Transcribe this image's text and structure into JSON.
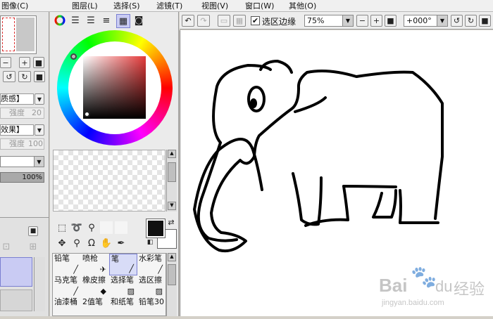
{
  "menu": [
    "图像(C)",
    "图层(L)",
    "选择(S)",
    "滤镜(T)",
    "视图(V)",
    "窗口(W)",
    "其他(O)"
  ],
  "left_panel": {
    "texture_label": "质感】",
    "texture_strength_label": "强度",
    "texture_strength_value": "20",
    "effect_label": "效果】",
    "effect_strength_label": "强度",
    "effect_strength_value": "100",
    "opacity_value": "100%"
  },
  "toolbar": {
    "selection_edge_label": "选区边缘",
    "selection_edge_checked": true,
    "zoom_value": "75%",
    "rotation_value": "+000°"
  },
  "tools": {
    "row1": [
      "铅笔",
      "喷枪",
      "笔",
      "水彩笔"
    ],
    "row2": [
      "马克笔",
      "橡皮擦",
      "选择笔",
      "选区擦"
    ],
    "row3": [
      "油漆桶",
      "2值笔",
      "和纸笔",
      "铅笔30"
    ]
  },
  "colors": {
    "primary": "#111111",
    "secondary": "#ffffff",
    "selected_tool_bg": "#d8dcf7",
    "layer_selected": "#c9cbf3"
  },
  "watermark": {
    "brand": "Bai",
    "paw": "du",
    "cn": "经验",
    "url": "jingyan.baidu.com"
  }
}
